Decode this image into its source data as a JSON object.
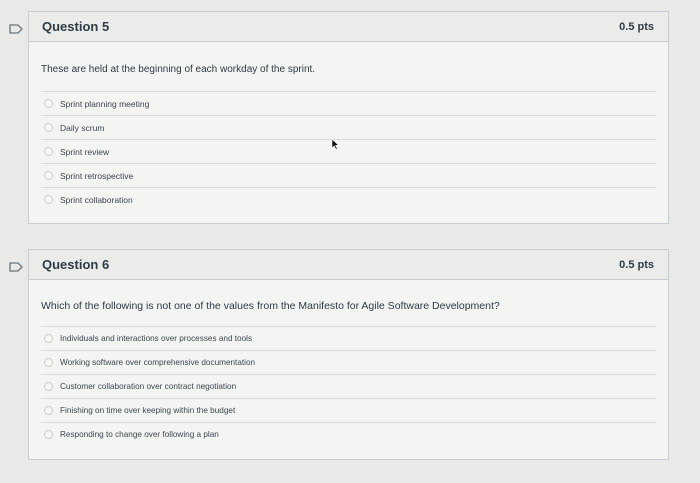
{
  "questions": [
    {
      "title": "Question 5",
      "points": "0.5 pts",
      "text": "These are held at the beginning of each workday of the sprint.",
      "answers": [
        "Sprint planning meeting",
        "Daily scrum",
        "Sprint review",
        "Sprint retrospective",
        "Sprint collaboration"
      ]
    },
    {
      "title": "Question 6",
      "points": "0.5 pts",
      "text": "Which of the following is not one of the values from the Manifesto for Agile Software Development?",
      "answers": [
        "Individuals and interactions over processes and tools",
        "Working software over comprehensive documentation",
        "Customer collaboration over contract negotiation",
        "Finishing on time over keeping within the budget",
        "Responding to change over following a plan"
      ]
    }
  ],
  "icons": {
    "flag": "bookmark-flag-icon",
    "cursor": "mouse-pointer-icon"
  },
  "colors": {
    "background": "#e9e9e7",
    "header": "#ebebea",
    "border": "#c9ccce",
    "text": "#2d3b45"
  }
}
